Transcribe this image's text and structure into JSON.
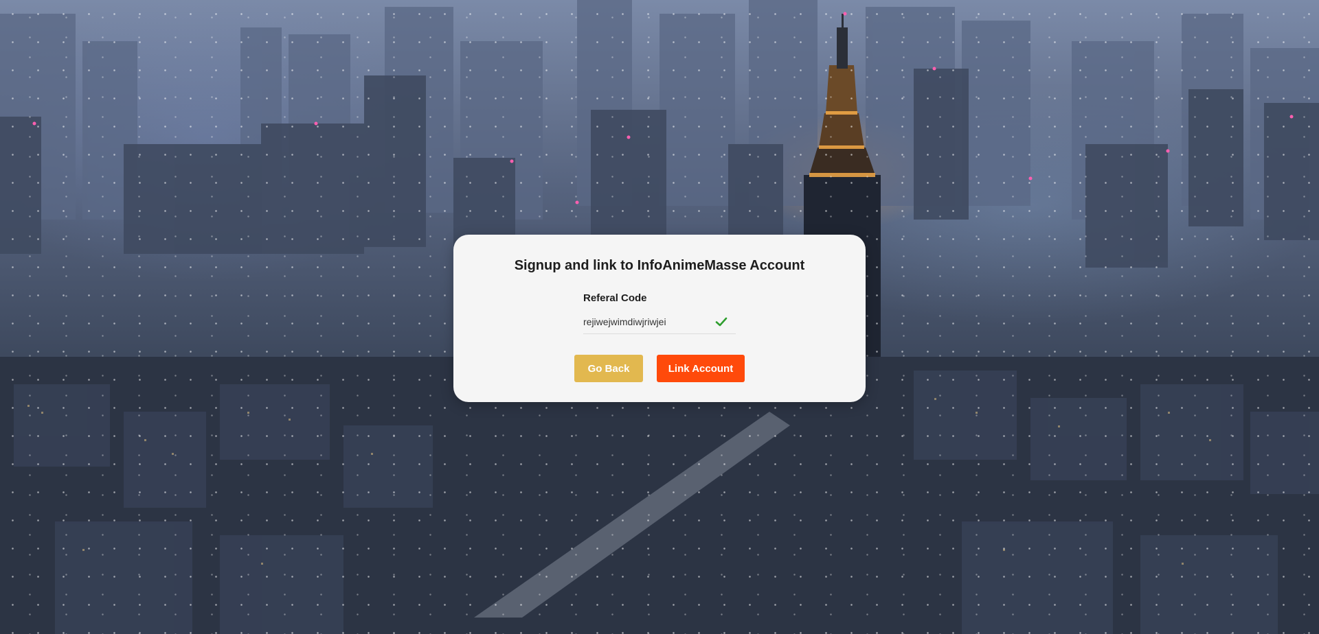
{
  "background": {
    "description_icon": "city-night-snow-background"
  },
  "signup": {
    "title": "Signup and link to InfoAnimeMasse Account",
    "referral_label": "Referal Code",
    "referral_value": "rejiwejwimdiwjriwjei",
    "valid_icon": "check-icon",
    "go_back_label": "Go Back",
    "link_account_label": "Link Account"
  },
  "colors": {
    "card_bg": "#f5f5f5",
    "go_back_bg": "#e2b84f",
    "link_account_bg": "#ff4a0b",
    "check_color": "#2e9e2e"
  }
}
